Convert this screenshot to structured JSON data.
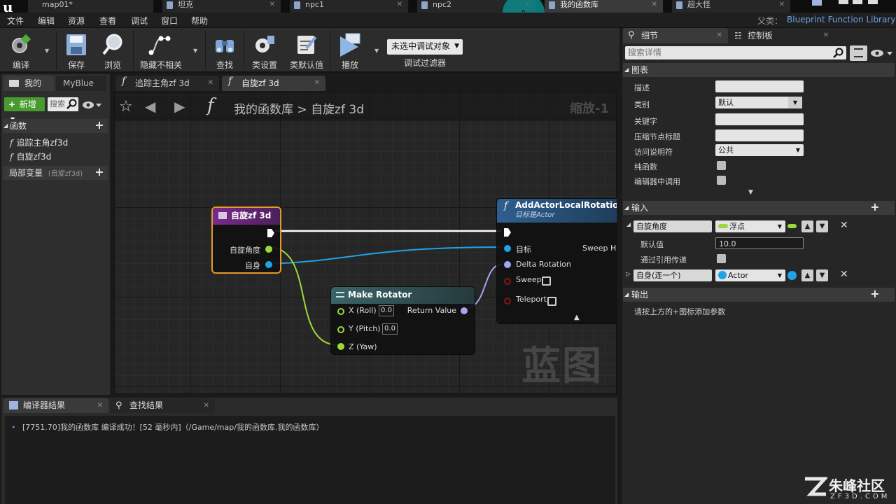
{
  "tabs": [
    {
      "label": "map01*"
    },
    {
      "label": "坦克"
    },
    {
      "label": "npc1"
    },
    {
      "label": "npc2"
    },
    {
      "label": "我的函数库"
    },
    {
      "label": "超大怪"
    }
  ],
  "menu": [
    "文件",
    "编辑",
    "资源",
    "查看",
    "调试",
    "窗口",
    "帮助"
  ],
  "parent": {
    "label": "父类：",
    "value": "Blueprint Function Library"
  },
  "toolbar": {
    "compile": "编译",
    "save": "保存",
    "browse": "浏览",
    "hide_unrelated": "隐藏不相关",
    "find": "查找",
    "class_settings": "类设置",
    "class_defaults": "类默认值",
    "play": "播放",
    "debug_select": "未选中调试对象",
    "debug_filter": "调试过滤器"
  },
  "left_panel": {
    "tab_mine": "我的",
    "tab_myblue": "MyBlue",
    "new_button": "新增",
    "search_placeholder": "搜索",
    "functions_header": "函数",
    "functions": [
      "追踪主角zf3d",
      "自旋zf3d"
    ],
    "local_vars_header": "局部变量",
    "local_vars_sub": "(自旋zf3d)"
  },
  "graph_tabs": [
    "追踪主角zf 3d",
    "自旋zf 3d"
  ],
  "breadcrumb": {
    "root": "我的函数库",
    "sep": ">",
    "current": "自旋zf 3d"
  },
  "zoom": "缩放-1",
  "watermark": "蓝图",
  "nodes": {
    "entry": {
      "title": "自旋zf 3d",
      "pins": [
        "自旋角度",
        "自身"
      ]
    },
    "make_rotator": {
      "title": "Make Rotator",
      "pins": [
        "X (Roll)",
        "Y (Pitch)",
        "Z (Yaw)"
      ],
      "x_value": "0.0",
      "y_value": "0.0",
      "output": "Return Value"
    },
    "add_rotation": {
      "title": "AddActorLocalRotation",
      "subtitle": "目标是Actor",
      "pins": [
        "目标",
        "Delta Rotation",
        "Sweep",
        "Teleport"
      ],
      "output": "Sweep Hit"
    }
  },
  "colors": {
    "entry_header": "#7a2b8e",
    "entry_border": "#e39a2b",
    "float_pin": "#9bd83b",
    "object_pin": "#1fa2e6",
    "rotator_pin": "#a3a6f2",
    "hitresult_pin": "#8a1414",
    "exec": "#ffffff"
  },
  "details": {
    "tab_details": "细节",
    "tab_control": "控制板",
    "search_placeholder": "搜索详情",
    "graph_section": "图表",
    "rows": {
      "desc": "描述",
      "category": "类别",
      "category_value": "默认",
      "keywords": "关键字",
      "compact_title": "压缩节点标题",
      "access": "访问说明符",
      "access_value": "公共",
      "pure": "纯函数",
      "call_in_editor": "编辑器中调用"
    },
    "inputs_section": "输入",
    "inputs": [
      {
        "name": "自旋角度",
        "type": "浮点"
      },
      {
        "name": "自身(连一个)",
        "type": "Actor"
      }
    ],
    "default_label": "默认值",
    "default_value": "10.0",
    "pass_by_ref": "通过引用传递",
    "outputs_section": "输出",
    "outputs_hint": "请按上方的+图标添加参数"
  },
  "bottom": {
    "tab_compiler": "编译器结果",
    "tab_find": "查找结果",
    "log": "[7751.70]我的函数库 编译成功！[52 毫秒内]（/Game/map/我的函数库.我的函数库）"
  },
  "site_logo": {
    "brand": "朱峰社区",
    "url": "ZF3D.COM"
  }
}
